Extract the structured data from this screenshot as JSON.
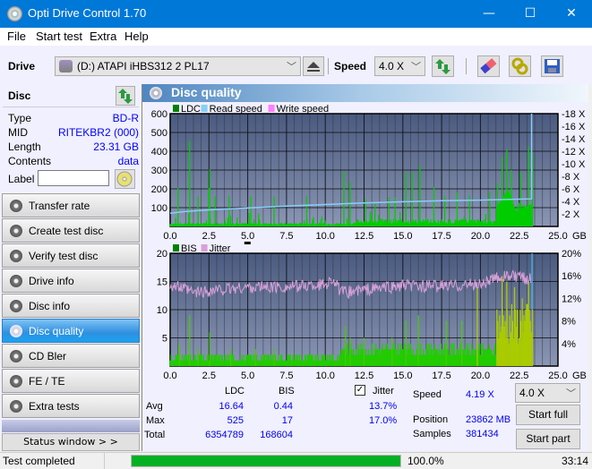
{
  "window": {
    "title": "Opti Drive Control 1.70",
    "minimize": "—",
    "maximize": "☐",
    "close": "✕"
  },
  "menu": [
    "File",
    "Start test",
    "Extra",
    "Help"
  ],
  "toolbar": {
    "drive_label": "Drive",
    "drive_value": "(D:)  ATAPI iHBS312  2 PL17",
    "speed_label": "Speed",
    "speed_value": "4.0 X"
  },
  "disc": {
    "header": "Disc",
    "rows": [
      {
        "key": "Type",
        "value": "BD-R"
      },
      {
        "key": "MID",
        "value": "RITEKBR2 (000)"
      },
      {
        "key": "Length",
        "value": "23.31 GB"
      },
      {
        "key": "Contents",
        "value": "data"
      }
    ],
    "label_key": "Label",
    "label_value": ""
  },
  "nav": [
    {
      "label": "Transfer rate",
      "active": false
    },
    {
      "label": "Create test disc",
      "active": false
    },
    {
      "label": "Verify test disc",
      "active": false
    },
    {
      "label": "Drive info",
      "active": false
    },
    {
      "label": "Disc info",
      "active": false
    },
    {
      "label": "Disc quality",
      "active": true
    },
    {
      "label": "CD Bler",
      "active": false
    },
    {
      "label": "FE / TE",
      "active": false
    },
    {
      "label": "Extra tests",
      "active": false
    }
  ],
  "status_window_btn": "Status window > >",
  "panel": {
    "title": "Disc quality"
  },
  "chart_data": [
    {
      "type": "bar",
      "title": "LDC",
      "legend": [
        "LDC",
        "Read speed",
        "Write speed"
      ],
      "legend_colors": [
        "#008000",
        "#87cefa",
        "#ff80ff"
      ],
      "x_ticks": [
        "0.0",
        "2.5",
        "5.0",
        "7.5",
        "10.0",
        "12.5",
        "15.0",
        "17.5",
        "20.0",
        "22.5",
        "25.0"
      ],
      "x_unit": "GB",
      "xlim": [
        0,
        25
      ],
      "y_ticks": [
        "100",
        "200",
        "300",
        "400",
        "500",
        "600"
      ],
      "ylim": [
        0,
        600
      ],
      "y2_ticks": [
        "2 X",
        "4 X",
        "6 X",
        "8 X",
        "10 X",
        "12 X",
        "14 X",
        "16 X",
        "18 X"
      ],
      "y2lim": [
        0,
        18
      ],
      "ldc_spikes": [
        [
          0.5,
          205
        ],
        [
          1.25,
          455
        ],
        [
          1.8,
          160
        ],
        [
          2.55,
          305
        ],
        [
          2.5,
          205
        ],
        [
          2.9,
          160
        ],
        [
          3.8,
          160
        ],
        [
          5.2,
          160
        ],
        [
          6.7,
          160
        ],
        [
          8.8,
          160
        ],
        [
          11.2,
          295
        ],
        [
          11.6,
          235
        ],
        [
          12.6,
          145
        ],
        [
          12.9,
          80
        ],
        [
          13.2,
          120
        ],
        [
          14.1,
          155
        ],
        [
          14.5,
          155
        ],
        [
          15.2,
          290
        ],
        [
          15.6,
          290
        ],
        [
          16.1,
          325
        ],
        [
          17.0,
          210
        ],
        [
          17.7,
          160
        ],
        [
          18.5,
          180
        ],
        [
          19.3,
          165
        ],
        [
          20.6,
          185
        ],
        [
          21.1,
          230
        ],
        [
          21.4,
          370
        ],
        [
          21.7,
          410
        ],
        [
          22.0,
          300
        ],
        [
          22.6,
          290
        ],
        [
          23.1,
          425
        ],
        [
          23.35,
          390
        ]
      ],
      "read_speed": [
        [
          0,
          2.1
        ],
        [
          1,
          2.4
        ],
        [
          2.5,
          2.65
        ],
        [
          5,
          2.95
        ],
        [
          7.5,
          3.25
        ],
        [
          10,
          3.5
        ],
        [
          12.5,
          3.75
        ],
        [
          15,
          3.95
        ],
        [
          17.5,
          4.1
        ],
        [
          20,
          4.2
        ],
        [
          22.5,
          4.35
        ],
        [
          23.3,
          4.4
        ],
        [
          23.3,
          18
        ]
      ]
    },
    {
      "type": "bar",
      "title": "BIS",
      "legend": [
        "BIS",
        "Jitter"
      ],
      "legend_colors": [
        "#008000",
        "#d8a0d8"
      ],
      "x_ticks": [
        "0.0",
        "2.5",
        "5.0",
        "7.5",
        "10.0",
        "12.5",
        "15.0",
        "17.5",
        "20.0",
        "22.5",
        "25.0"
      ],
      "x_unit": "GB",
      "xlim": [
        0,
        25
      ],
      "y_ticks": [
        "5",
        "10",
        "15",
        "20"
      ],
      "ylim": [
        0,
        20
      ],
      "y2_ticks": [
        "4%",
        "8%",
        "12%",
        "16%",
        "20%"
      ],
      "y2lim": [
        0,
        20
      ],
      "bis_spikes": [
        [
          0.6,
          4
        ],
        [
          1.25,
          9
        ],
        [
          1.8,
          3
        ],
        [
          2.55,
          6
        ],
        [
          3.9,
          3
        ],
        [
          5.5,
          3
        ],
        [
          6.7,
          3
        ],
        [
          11.3,
          7
        ],
        [
          11.6,
          5
        ],
        [
          12.5,
          5
        ],
        [
          14.3,
          5
        ],
        [
          15.2,
          8
        ],
        [
          16.0,
          9
        ],
        [
          17.8,
          8
        ],
        [
          18.8,
          8
        ],
        [
          19.8,
          14
        ],
        [
          21.4,
          16
        ],
        [
          21.7,
          15
        ],
        [
          22.2,
          14
        ],
        [
          22.7,
          12
        ],
        [
          23.1,
          15
        ],
        [
          23.35,
          10
        ]
      ],
      "jitter_mean": [
        [
          0,
          14.5
        ],
        [
          1.5,
          13
        ],
        [
          2.5,
          13.3
        ],
        [
          5,
          14
        ],
        [
          7.5,
          14
        ],
        [
          10,
          14.5
        ],
        [
          10.5,
          15.5
        ],
        [
          11,
          13
        ],
        [
          12.5,
          13.5
        ],
        [
          15,
          14.2
        ],
        [
          17.5,
          14.2
        ],
        [
          20,
          14.5
        ],
        [
          21.5,
          16
        ],
        [
          23.3,
          15.5
        ]
      ]
    }
  ],
  "stats": {
    "col_ldc": "LDC",
    "col_bis": "BIS",
    "rows": [
      {
        "label": "Avg",
        "ldc": "16.64",
        "bis": "0.44",
        "jitter": "13.7%"
      },
      {
        "label": "Max",
        "ldc": "525",
        "bis": "17",
        "jitter": "17.0%"
      },
      {
        "label": "Total",
        "ldc": "6354789",
        "bis": "168604"
      }
    ],
    "jitter_label": "Jitter",
    "jitter_checked": true,
    "speed_label": "Speed",
    "speed_value": "4.19 X",
    "position_label": "Position",
    "position_value": "23862 MB",
    "samples_label": "Samples",
    "samples_value": "381434",
    "speed_select": "4.0 X",
    "start_full": "Start full",
    "start_part": "Start part"
  },
  "statusbar": {
    "text": "Test completed",
    "progress_pct": 100,
    "progress_text": "100.0%",
    "time": "33:14"
  },
  "colors": {
    "titlebar": "#0078d7",
    "progress": "#06b025",
    "ldc": "#00cc00",
    "read_speed": "#87cefa",
    "jitter": "#d8a0d8"
  }
}
